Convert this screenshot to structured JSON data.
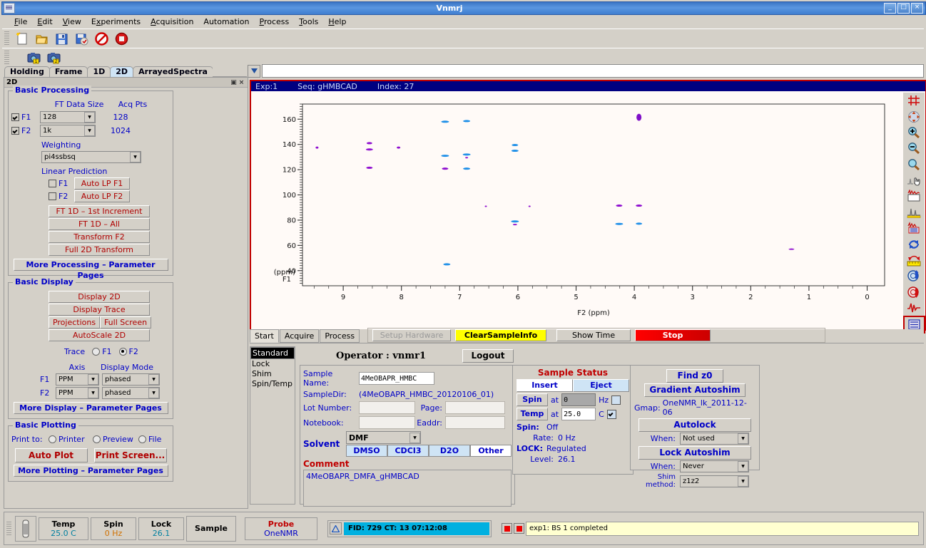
{
  "window": {
    "title": "Vnmrj",
    "minimize": "_",
    "maximize": "□",
    "close": "×"
  },
  "menubar": [
    {
      "label": "File",
      "accel": "F"
    },
    {
      "label": "Edit",
      "accel": "E"
    },
    {
      "label": "View",
      "accel": "V"
    },
    {
      "label": "Experiments",
      "accel": "x"
    },
    {
      "label": "Acquisition",
      "accel": "A"
    },
    {
      "label": "Automation",
      "accel": ""
    },
    {
      "label": "Process",
      "accel": "P"
    },
    {
      "label": "Tools",
      "accel": "T"
    },
    {
      "label": "Help",
      "accel": "H"
    }
  ],
  "toolbar_main": [
    {
      "name": "new-file-icon"
    },
    {
      "name": "open-folder-icon"
    },
    {
      "name": "save-icon"
    },
    {
      "name": "save-as-icon"
    },
    {
      "name": "abort-icon"
    },
    {
      "name": "stop-icon"
    }
  ],
  "toolbar_secondary": [
    {
      "name": "camera-1-icon",
      "badge": "1"
    },
    {
      "name": "camera-2-icon",
      "badge": "2"
    }
  ],
  "toolbar_right": [
    {
      "name": "fid-display-icon"
    },
    {
      "name": "spectrum-display-icon"
    },
    {
      "name": "target-display-icon"
    }
  ],
  "tabs": [
    {
      "label": "Holding",
      "active": false
    },
    {
      "label": "Frame",
      "active": false
    },
    {
      "label": "1D",
      "active": false
    },
    {
      "label": "2D",
      "active": true
    },
    {
      "label": "ArrayedSpectra",
      "active": false
    }
  ],
  "command_line": {
    "value": "",
    "placeholder": ""
  },
  "left_panel": {
    "header_title": "2D",
    "pin_icon": "▣",
    "close_icon": "×",
    "basic_processing": {
      "title": "Basic Processing",
      "col_ft": "FT Data Size",
      "col_acq": "Acq Pts",
      "rows": [
        {
          "label": "F1",
          "checked": true,
          "size": "128",
          "acq": "128"
        },
        {
          "label": "F2",
          "checked": true,
          "size": "1k",
          "acq": "1024"
        }
      ],
      "weighting_label": "Weighting",
      "weighting_value": "pi4ssbsq",
      "lp_label": "Linear Prediction",
      "lp_rows": [
        {
          "label": "F1",
          "checked": false,
          "button": "Auto LP  F1"
        },
        {
          "label": "F2",
          "checked": false,
          "button": "Auto LP  F2"
        }
      ],
      "buttons": [
        "FT 1D – 1st Increment",
        "FT 1D – All",
        "Transform F2",
        "Full 2D Transform"
      ],
      "more_button": "More Processing – Parameter Pages"
    },
    "basic_display": {
      "title": "Basic Display",
      "buttons_full": [
        "Display 2D",
        "Display Trace"
      ],
      "buttons_half": [
        "Projections",
        "Full Screen"
      ],
      "buttons_full2": [
        "AutoScale 2D"
      ],
      "trace_label": "Trace",
      "trace_options": [
        {
          "label": "F1",
          "selected": false
        },
        {
          "label": "F2",
          "selected": true
        }
      ],
      "col_axis": "Axis",
      "col_mode": "Display Mode",
      "rows": [
        {
          "label": "F1",
          "axis": "PPM",
          "mode": "phased"
        },
        {
          "label": "F2",
          "axis": "PPM",
          "mode": "phased"
        }
      ],
      "more_button": "More Display – Parameter Pages"
    },
    "basic_plotting": {
      "title": "Basic Plotting",
      "print_to_label": "Print to:",
      "print_options": [
        {
          "label": "Printer",
          "selected": false
        },
        {
          "label": "Preview",
          "selected": false
        },
        {
          "label": "File",
          "selected": false
        }
      ],
      "buttons": [
        "Auto Plot",
        "Print Screen..."
      ],
      "more_button": "More Plotting – Parameter Pages"
    }
  },
  "spectrum": {
    "header": {
      "exp": "Exp:1",
      "seq": "Seq: gHMBCAD",
      "index": "Index: 27"
    },
    "border_color": "#c00000",
    "background": "#fffaf7"
  },
  "chart_data": {
    "type": "scatter",
    "title": "",
    "xlabel": "F2 (ppm)",
    "ylabel": "F1\n(ppm)",
    "xlim": [
      9.7,
      -0.3
    ],
    "ylim": [
      172,
      28
    ],
    "xticks": [
      9,
      8,
      7,
      6,
      5,
      4,
      3,
      2,
      1,
      0
    ],
    "yticks": [
      40,
      60,
      80,
      100,
      120,
      140,
      160
    ],
    "grid": false,
    "legend": null,
    "peaks": [
      {
        "x": 7.22,
        "y": 45.0,
        "w": 10,
        "h": 3,
        "color": "#2090e8"
      },
      {
        "x": 1.3,
        "y": 57.0,
        "w": 8,
        "h": 2,
        "color": "#9010d0"
      },
      {
        "x": 6.05,
        "y": 76.5,
        "w": 6,
        "h": 2,
        "color": "#9010d0"
      },
      {
        "x": 6.05,
        "y": 79.0,
        "w": 11,
        "h": 3,
        "color": "#2090e8"
      },
      {
        "x": 4.26,
        "y": 77.0,
        "w": 11,
        "h": 3,
        "color": "#2090e8"
      },
      {
        "x": 3.92,
        "y": 77.2,
        "w": 9,
        "h": 3,
        "color": "#2090e8"
      },
      {
        "x": 6.55,
        "y": 91.0,
        "w": 3,
        "h": 2,
        "color": "#9010d0"
      },
      {
        "x": 5.8,
        "y": 91.0,
        "w": 3,
        "h": 2,
        "color": "#9010d0"
      },
      {
        "x": 4.26,
        "y": 91.5,
        "w": 9,
        "h": 3,
        "color": "#9010d0"
      },
      {
        "x": 3.92,
        "y": 91.5,
        "w": 9,
        "h": 3,
        "color": "#9010d0"
      },
      {
        "x": 8.55,
        "y": 121.5,
        "w": 9,
        "h": 3,
        "color": "#9010d0"
      },
      {
        "x": 7.25,
        "y": 120.8,
        "w": 9,
        "h": 3,
        "color": "#9010d0"
      },
      {
        "x": 6.88,
        "y": 120.8,
        "w": 10,
        "h": 3,
        "color": "#2090e8"
      },
      {
        "x": 7.25,
        "y": 131.0,
        "w": 11,
        "h": 3,
        "color": "#2090e8"
      },
      {
        "x": 6.88,
        "y": 129.5,
        "w": 4,
        "h": 2,
        "color": "#9010d0"
      },
      {
        "x": 6.88,
        "y": 132.0,
        "w": 11,
        "h": 3,
        "color": "#2090e8"
      },
      {
        "x": 9.45,
        "y": 137.5,
        "w": 4,
        "h": 3,
        "color": "#9010d0"
      },
      {
        "x": 8.55,
        "y": 136.0,
        "w": 10,
        "h": 3,
        "color": "#9010d0"
      },
      {
        "x": 8.55,
        "y": 141.0,
        "w": 8,
        "h": 3,
        "color": "#9010d0"
      },
      {
        "x": 8.05,
        "y": 137.5,
        "w": 5,
        "h": 3,
        "color": "#9010d0"
      },
      {
        "x": 6.05,
        "y": 135.0,
        "w": 10,
        "h": 3,
        "color": "#2090e8"
      },
      {
        "x": 6.05,
        "y": 139.5,
        "w": 9,
        "h": 3,
        "color": "#2090e8"
      },
      {
        "x": 7.25,
        "y": 158.0,
        "w": 11,
        "h": 3,
        "color": "#2090e8"
      },
      {
        "x": 6.88,
        "y": 158.5,
        "w": 10,
        "h": 3,
        "color": "#2090e8"
      },
      {
        "x": 3.92,
        "y": 161.5,
        "w": 6,
        "h": 7,
        "color": "#2090e8"
      }
    ]
  },
  "vertical_toolbar": [
    {
      "name": "crosshair-grid-icon"
    },
    {
      "name": "pan-move-icon"
    },
    {
      "name": "zoom-in-icon"
    },
    {
      "name": "zoom-out-icon"
    },
    {
      "name": "zoom-full-icon"
    },
    {
      "name": "cursor-hand-icon"
    },
    {
      "name": "threshold-box-icon"
    },
    {
      "name": "peak-pick-icon"
    },
    {
      "name": "integrate-ruler-icon"
    },
    {
      "name": "refresh-icon"
    },
    {
      "name": "scale-ruler-icon"
    },
    {
      "name": "phase-up-icon"
    },
    {
      "name": "phase-down-icon"
    },
    {
      "name": "spectrum-trace-icon"
    },
    {
      "name": "display-list-icon"
    },
    {
      "name": "reset-green-icon"
    }
  ],
  "vertical_toolbar_close": "×",
  "control_panel": {
    "tabs": [
      {
        "label": "Start",
        "active": true,
        "disabled": false
      },
      {
        "label": "Acquire",
        "active": false,
        "disabled": false
      },
      {
        "label": "Process",
        "active": false,
        "disabled": false
      }
    ],
    "buttons": [
      {
        "label": "Setup Hardware",
        "style": "dim"
      },
      {
        "label": "ClearSampleInfo",
        "style": "yellow"
      },
      {
        "label": "Show Time",
        "style": "normal"
      },
      {
        "label": "Stop",
        "style": "stopred"
      }
    ],
    "side_list": [
      {
        "label": "Standard",
        "selected": true
      },
      {
        "label": "Lock",
        "selected": false
      },
      {
        "label": "Shim",
        "selected": false
      },
      {
        "label": "Spin/Temp",
        "selected": false
      }
    ],
    "operator_label": "Operator : vnmr1",
    "logout_button": "Logout",
    "sample_form": {
      "sample_name_label": "Sample Name:",
      "sample_name_value": "4MeOBAPR_HMBC",
      "sample_dir_label": "SampleDir:",
      "sample_dir_value": "(4MeOBAPR_HMBC_20120106_01)",
      "lot_label": "Lot Number:",
      "lot_value": "",
      "page_label": "Page:",
      "page_value": "",
      "notebook_label": "Notebook:",
      "notebook_value": "",
      "eaddr_label": "Eaddr:",
      "eaddr_value": "",
      "solvent_label": "Solvent",
      "solvent_value": "DMF",
      "solvent_buttons": [
        {
          "label": "DMSO",
          "active": false
        },
        {
          "label": "CDCI3",
          "active": false
        },
        {
          "label": "D2O",
          "active": false
        },
        {
          "label": "Other",
          "active": true
        }
      ],
      "comment_label": "Comment",
      "comment_value": "4MeOBAPR_DMFA_gHMBCAD"
    },
    "sample_status": {
      "title": "Sample Status",
      "insert_button": "Insert",
      "eject_button": "Eject",
      "spin_button": "Spin",
      "spin_at": "at",
      "spin_value": "0",
      "spin_unit": "Hz",
      "spin_checked": false,
      "temp_button": "Temp",
      "temp_at": "at",
      "temp_value": "25.0",
      "temp_unit": "C",
      "temp_checked": true,
      "spin_label": "Spin:",
      "spin_state": "Off",
      "rate_label": "Rate:",
      "rate_value": "0 Hz",
      "lock_label": "LOCK:",
      "lock_state": "Regulated",
      "level_label": "Level:",
      "level_value": "26.1"
    },
    "shim_panel": {
      "find_z0_button": "Find z0",
      "gradient_autoshim_button": "Gradient Autoshim",
      "gmap_label": "Gmap:",
      "gmap_value": "OneNMR_lk_2011-12-06",
      "autolock_button": "Autolock",
      "autolock_when_label": "When:",
      "autolock_when_value": "Not used",
      "lock_autoshim_button": "Lock Autoshim",
      "lock_when_label": "When:",
      "lock_when_value": "Never",
      "shim_method_label": "Shim method:",
      "shim_method_value": "z1z2"
    }
  },
  "status_bar": {
    "probe_icon": "probe-tube-icon",
    "cells": [
      {
        "title": "Temp",
        "value": "25.0 C",
        "color": "#0080a0"
      },
      {
        "title": "Spin",
        "value": "0 Hz",
        "color": "#d07000"
      },
      {
        "title": "Lock",
        "value": "26.1",
        "color": "#0080a0"
      },
      {
        "title": "Sample",
        "value": "",
        "color": "#000000"
      }
    ],
    "probe_title": "Probe",
    "probe_value": "OneNMR",
    "warning_icon": "warning-triangle-icon",
    "fid_text": "FID: 729 CT: 13  07:12:08",
    "message": "exp1:  BS 1 completed"
  }
}
